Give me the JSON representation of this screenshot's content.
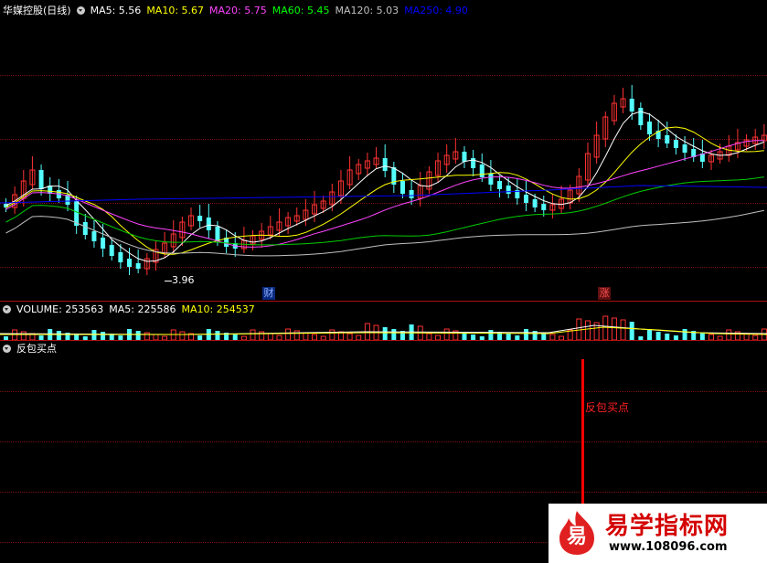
{
  "main_chart": {
    "title": "华媒控股(日线)",
    "ma_labels": [
      {
        "text": "MA5: 5.56",
        "color": "#ffffff"
      },
      {
        "text": "MA10: 5.67",
        "color": "#ffff00"
      },
      {
        "text": "MA20: 5.75",
        "color": "#ff44ff"
      },
      {
        "text": "MA60: 5.45",
        "color": "#00ff00"
      },
      {
        "text": "MA120: 5.03",
        "color": "#c0c0c0"
      },
      {
        "text": "MA250: 4.90",
        "color": "#0000ff"
      }
    ],
    "low_marker": "3.96",
    "event_markers": [
      {
        "text": "财",
        "color": "#4080ff"
      },
      {
        "text": "涨",
        "color": "#ff3030"
      }
    ]
  },
  "volume_panel": {
    "volume_label": "VOLUME: 253563",
    "ma5_label": "MA5: 225586",
    "ma10_label": "MA10: 254537",
    "volume_color": "#ffffff",
    "ma5_color": "#ffffff",
    "ma10_color": "#ffff00"
  },
  "indicator_panel": {
    "title": "反包买点",
    "signal_label": "反包买点",
    "signal_color": "#ff0000"
  },
  "watermark": {
    "badge_char": "易",
    "name": "易学指标网",
    "url": "www.108096.com"
  },
  "colors": {
    "background": "#000000",
    "up_candle": "#ff3232",
    "down_candle": "#54ffff",
    "separator": "#b01010",
    "ma250": "#0000ff"
  }
}
